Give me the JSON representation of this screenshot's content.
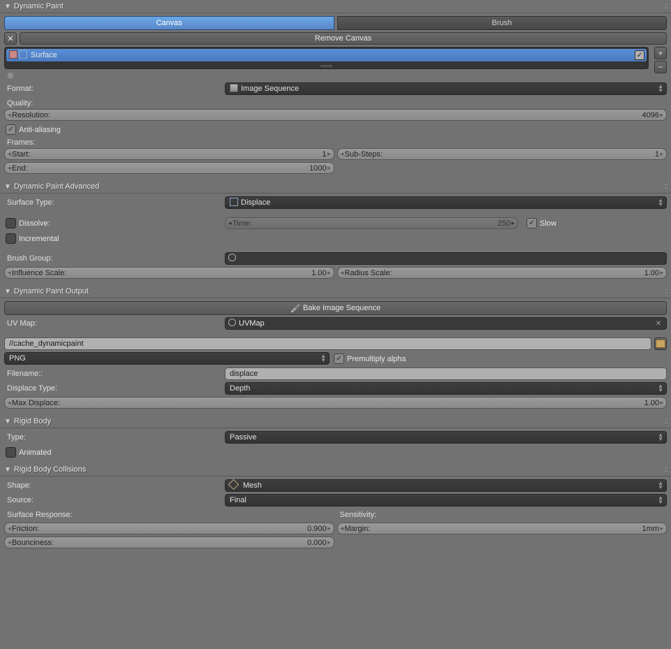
{
  "panels": {
    "dynamicPaint": {
      "title": "Dynamic Paint",
      "tabs": {
        "canvas": "Canvas",
        "brush": "Brush"
      },
      "removeBtn": "Remove Canvas",
      "surfaceItem": "Surface",
      "formatLabel": "Format:",
      "formatValue": "Image Sequence",
      "qualityLabel": "Quality:",
      "resolution": {
        "label": "Resolution:",
        "value": "4096"
      },
      "antialias": "Anti-aliasing",
      "framesLabel": "Frames:",
      "start": {
        "label": "Start:",
        "value": "1"
      },
      "end": {
        "label": "End:",
        "value": "1000"
      },
      "substeps": {
        "label": "Sub-Steps:",
        "value": "1"
      }
    },
    "advanced": {
      "title": "Dynamic Paint Advanced",
      "surfaceTypeLabel": "Surface Type:",
      "surfaceTypeValue": "Displace",
      "dissolve": "Dissolve:",
      "time": {
        "label": "Time:",
        "value": "250"
      },
      "slow": "Slow",
      "incremental": "Incremental",
      "brushGroupLabel": "Brush Group:",
      "influence": {
        "label": "Influence Scale:",
        "value": "1.00"
      },
      "radius": {
        "label": "Radius Scale:",
        "value": "1.00"
      }
    },
    "output": {
      "title": "Dynamic Paint Output",
      "bakeBtn": "Bake Image Sequence",
      "uvMapLabel": "UV Map:",
      "uvMapValue": "UVMap",
      "cachePath": "//cache_dynamicpaint",
      "fileFormat": "PNG",
      "premultiply": "Premultiply alpha",
      "filenameLabel": "Filename::",
      "filenameValue": "displace",
      "displaceTypeLabel": "Displace Type:",
      "displaceTypeValue": "Depth",
      "maxDisplace": {
        "label": "Max Displace:",
        "value": "1.00"
      }
    },
    "rigidBody": {
      "title": "Rigid Body",
      "typeLabel": "Type:",
      "typeValue": "Passive",
      "animated": "Animated"
    },
    "rigidBodyCollisions": {
      "title": "Rigid Body Collisions",
      "shapeLabel": "Shape:",
      "shapeValue": "Mesh",
      "sourceLabel": "Source:",
      "sourceValue": "Final",
      "surfaceResponseLabel": "Surface Response:",
      "sensitivityLabel": "Sensitivity:",
      "friction": {
        "label": "Friction:",
        "value": "0.900"
      },
      "bounciness": {
        "label": "Bounciness:",
        "value": "0.000"
      },
      "margin": {
        "label": "Margin:",
        "value": "1mm"
      }
    }
  }
}
